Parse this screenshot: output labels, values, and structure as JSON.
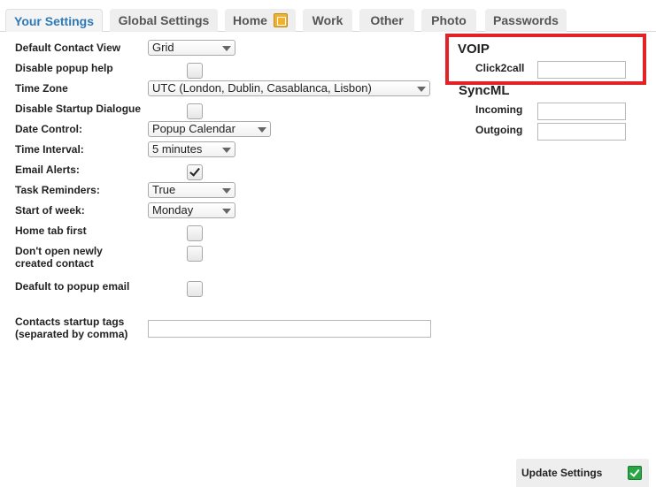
{
  "tabs": [
    {
      "label": "Your Settings",
      "active": true
    },
    {
      "label": "Global Settings"
    },
    {
      "label": "Home",
      "icon": "home-settings-icon"
    },
    {
      "label": "Work"
    },
    {
      "label": "Other"
    },
    {
      "label": "Photo"
    },
    {
      "label": "Passwords"
    }
  ],
  "form": {
    "default_contact_view": {
      "label": "Default Contact View",
      "value": "Grid"
    },
    "disable_popup_help": {
      "label": "Disable popup help",
      "checked": false
    },
    "time_zone": {
      "label": "Time Zone",
      "value": "UTC (London, Dublin, Casablanca, Lisbon)"
    },
    "disable_startup_dialogue": {
      "label": "Disable Startup Dialogue",
      "checked": false
    },
    "date_control": {
      "label": "Date Control:",
      "value": "Popup Calendar"
    },
    "time_interval": {
      "label": "Time Interval:",
      "value": "5 minutes"
    },
    "email_alerts": {
      "label": "Email Alerts:",
      "checked": true
    },
    "task_reminders": {
      "label": "Task Reminders:",
      "value": "True"
    },
    "start_of_week": {
      "label": "Start of week:",
      "value": "Monday"
    },
    "home_tab_first": {
      "label": "Home tab first",
      "checked": false
    },
    "dont_open_new_contact": {
      "label_line1": "Don't open newly",
      "label_line2": "created contact",
      "checked": false
    },
    "default_popup_email": {
      "label": "Deafult to popup email",
      "checked": false
    },
    "contacts_startup_tags": {
      "label_line1": "Contacts startup tags",
      "label_line2": "(separated by comma)",
      "value": ""
    }
  },
  "voip": {
    "title": "VOIP",
    "click2call": {
      "label": "Click2call",
      "value": ""
    }
  },
  "syncml": {
    "title": "SyncML",
    "incoming": {
      "label": "Incoming",
      "value": ""
    },
    "outgoing": {
      "label": "Outgoing",
      "value": ""
    }
  },
  "update_button": {
    "label": "Update Settings",
    "icon": "checkmark-icon"
  },
  "colors": {
    "active_tab": "#2e7ab8",
    "highlight_border": "#e32228",
    "ok_icon": "#27a644"
  }
}
